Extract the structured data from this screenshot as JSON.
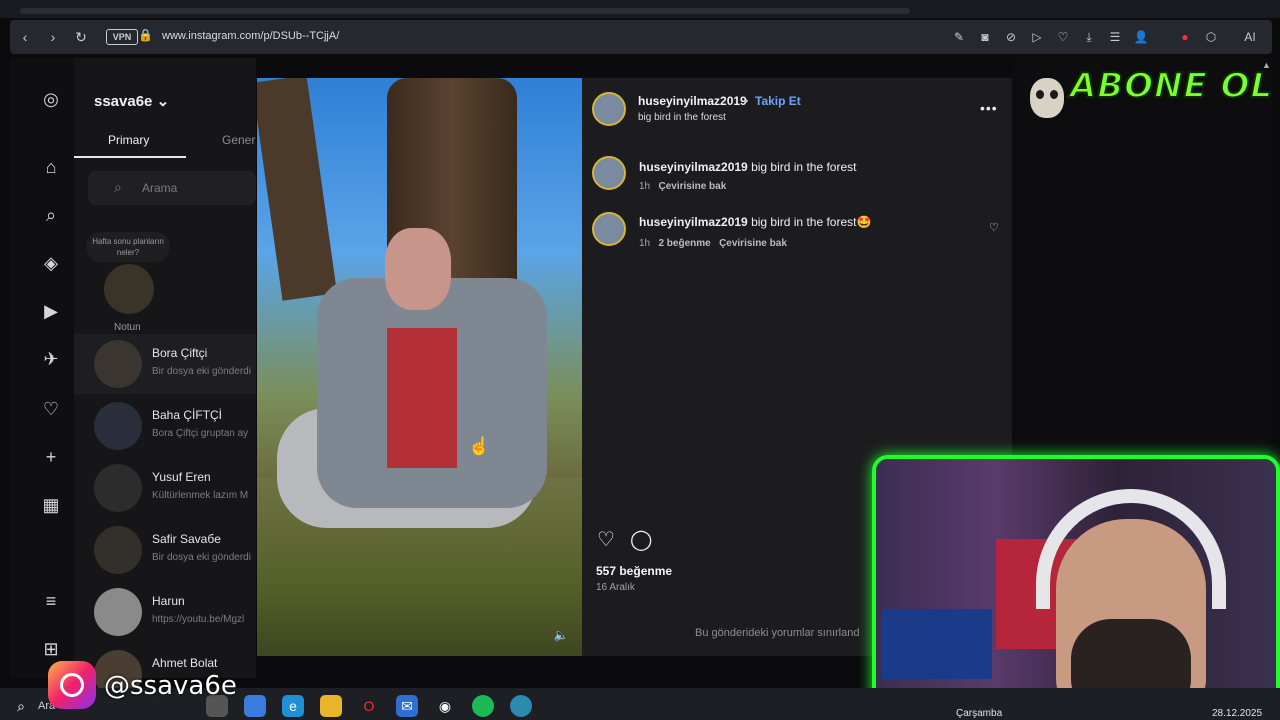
{
  "browser": {
    "url": "www.instagram.com/p/DSUb--TCjjA/",
    "vpn_label": "VPN",
    "ai_label": "AI"
  },
  "sidebar": {
    "username": "ssava6e",
    "tabs": [
      "Primary",
      "Gener"
    ],
    "search_placeholder": "Arama",
    "note_text": "Hafta sonu planların neler?",
    "note_label": "Notun",
    "conversations": [
      {
        "name": "Bora Çiftçi",
        "preview": "Bir dosya eki gönderdi"
      },
      {
        "name": "Baha ÇİFTÇİ",
        "preview": "Bora Çiftçi gruptan ay"
      },
      {
        "name": "Yusuf Eren",
        "preview": "Kültürlenmek lazım M"
      },
      {
        "name": "Safir Savaбe",
        "preview": "Bir dosya eki gönderdi"
      },
      {
        "name": "Harun",
        "preview": "https://youtu.be/Mgzl"
      },
      {
        "name": "Ahmet Bolat",
        "preview": ""
      }
    ]
  },
  "post": {
    "author": "huseyinyilmaz2019",
    "dot": "•",
    "follow": "Takip Et",
    "caption": "big bird in the forest",
    "comments": [
      {
        "user": "huseyinyilmaz2019",
        "text": "big bird in the forest",
        "time": "1h",
        "likes": "",
        "translate": "Çevirisine bak"
      },
      {
        "user": "huseyinyilmaz2019",
        "text": "big bird in the forest🤩",
        "time": "1h",
        "likes": "2 beğenme",
        "translate": "Çevirisine bak"
      }
    ],
    "like_count": "557 beğenme",
    "date": "16 Aralık",
    "comments_limited": "Bu gönderideki yorumlar sınırland"
  },
  "overlay": {
    "abone": "ABONE OL",
    "handle": "@ssava6e"
  },
  "taskbar": {
    "search_label": "Ara",
    "day": "Çarşamba",
    "date": "28.12.2025"
  }
}
